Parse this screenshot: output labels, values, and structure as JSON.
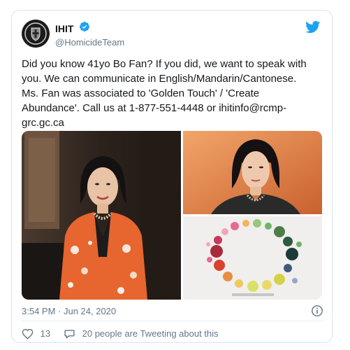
{
  "author": {
    "display_name": "IHIT",
    "handle": "@HomicideTeam",
    "avatar_icon": "crest-logo-icon",
    "verified_icon": "verified-badge-icon",
    "verified_color": "#1da1f2"
  },
  "tweet": {
    "text": "Did you know 41yo Bo Fan? If you did, we want to speak with\nyou. We can communicate in English/Mandarin/Cantonese.\nMs. Fan was associated to 'Golden Touch' / 'Create\nAbundance'. Call us at 1-877-551-4448 or ihitinfo@rcmp-\ngrc.gc.ca",
    "timestamp": "3:54 PM · Jun 24, 2020"
  },
  "media": {
    "photos": [
      {
        "icon": "woman-portrait-orange-jacket-photo"
      },
      {
        "icon": "woman-portrait-closeup-photo"
      },
      {
        "icon": "colorful-dot-ring-logo-photo"
      }
    ]
  },
  "actions": {
    "like_count": "13",
    "conversation_text": "20 people are Tweeting about this",
    "like_icon": "heart-icon",
    "conversation_icon": "speech-bubble-icon",
    "info_icon": "info-icon"
  },
  "brand": {
    "twitter_icon": "twitter-bird-icon",
    "accent_color": "#1da1f2",
    "muted_text_color": "#657786"
  }
}
